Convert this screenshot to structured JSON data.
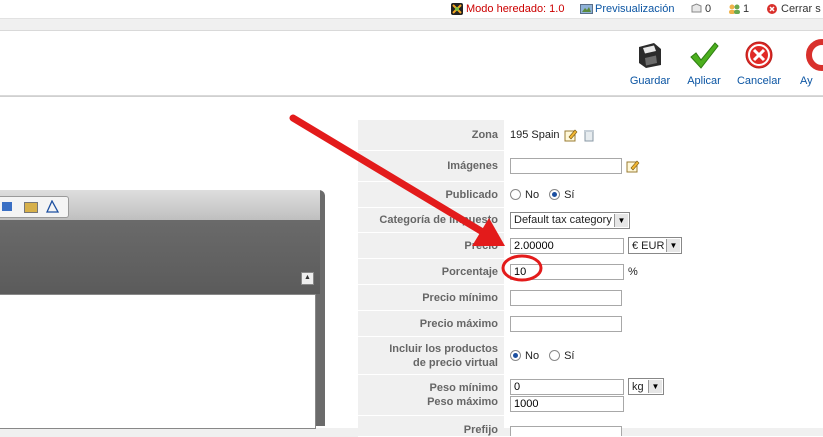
{
  "topbar": {
    "legacy_mode": "Modo heredado: 1.0",
    "preview": "Previsualización",
    "messages_count": "0",
    "users_count": "1",
    "logout": "Cerrar s"
  },
  "toolbar": {
    "save": "Guardar",
    "apply": "Aplicar",
    "cancel": "Cancelar",
    "help": "Ay"
  },
  "form": {
    "zona_label": "Zona",
    "zona_value": "195 Spain",
    "imagenes_label": "Imágenes",
    "imagenes_value": "",
    "publicado_label": "Publicado",
    "publicado_no": "No",
    "publicado_si": "Sí",
    "publicado_selected": "Sí",
    "categoria_label": "Categoría de impuesto",
    "categoria_value": "Default tax category",
    "precio_label": "Precio",
    "precio_value": "2.00000",
    "moneda_value": "€ EUR",
    "porcentaje_label": "Porcentaje",
    "porcentaje_value": "10",
    "porcentaje_unit": "%",
    "precio_minimo_label": "Precio mínimo",
    "precio_minimo_value": "",
    "precio_maximo_label": "Precio máximo",
    "precio_maximo_value": "",
    "virtual_label_1": "Incluir los productos",
    "virtual_label_2": "de precio virtual",
    "virtual_no": "No",
    "virtual_si": "Sí",
    "virtual_selected": "No",
    "peso_minimo_label": "Peso mínimo",
    "peso_minimo_value": "0",
    "peso_unit": "kg",
    "peso_maximo_label": "Peso máximo",
    "peso_maximo_value": "1000",
    "prefijo_label": "Prefijo"
  },
  "colors": {
    "annotation_red": "#e31b1b",
    "link_blue": "#0b55a3"
  },
  "icons": {
    "save": "floppy-disk-icon",
    "apply": "checkmark-icon",
    "cancel": "red-x-icon",
    "help": "lifebuoy-icon"
  }
}
